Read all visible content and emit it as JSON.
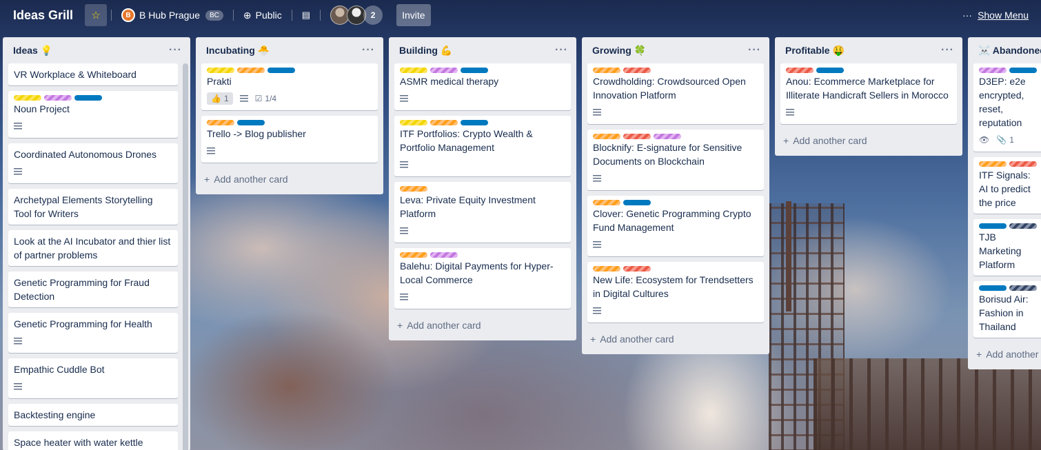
{
  "header": {
    "board_title": "Ideas Grill",
    "team_name": "B Hub Prague",
    "team_badge": "BC",
    "visibility": "Public",
    "member_overflow": "2",
    "invite_label": "Invite",
    "menu_label": "Show Menu"
  },
  "lists": [
    {
      "title": "Ideas 💡",
      "add_label": "Add another card",
      "cards": [
        {
          "title": "VR Workplace & Whiteboard"
        },
        {
          "title": "Noun Project"
        },
        {
          "title": "Coordinated Autonomous Drones"
        },
        {
          "title": "Archetypal Elements Storytelling Tool for Writers"
        },
        {
          "title": "Look at the AI Incubator and thier list of partner problems"
        },
        {
          "title": "Genetic Programming for Fraud Detection"
        },
        {
          "title": "Genetic Programming for Health"
        },
        {
          "title": "Empathic Cuddle Bot"
        },
        {
          "title": "Backtesting engine"
        },
        {
          "title": "Space heater with water kettle"
        }
      ]
    },
    {
      "title": "Incubating 🐣",
      "add_label": "Add another card",
      "cards": [
        {
          "title": "Prakti",
          "votes": "1",
          "checklist": "1/4"
        },
        {
          "title": "Trello -> Blog publisher"
        }
      ]
    },
    {
      "title": "Building 💪",
      "add_label": "Add another card",
      "cards": [
        {
          "title": "ASMR medical therapy"
        },
        {
          "title": "ITF Portfolios: Crypto Wealth & Portfolio Management"
        },
        {
          "title": "Leva: Private Equity Investment Platform"
        },
        {
          "title": "Balehu: Digital Payments for Hyper-Local Commerce"
        }
      ]
    },
    {
      "title": "Growing 🍀",
      "add_label": "Add another card",
      "cards": [
        {
          "title": "Crowdholding: Crowdsourced Open Innovation Platform"
        },
        {
          "title": "Blocknify: E-signature for Sensitive Documents on Blockchain"
        },
        {
          "title": "Clover: Genetic Programming Crypto Fund Management"
        },
        {
          "title": "New Life: Ecosystem for Trendsetters in Digital Cultures"
        }
      ]
    },
    {
      "title": "Profitable 🤑",
      "add_label": "Add another card",
      "cards": [
        {
          "title": "Anou: Ecommerce Marketplace for Illiterate Handicraft Sellers in Morocco"
        }
      ]
    },
    {
      "title": "☠️ Abandoned",
      "add_label": "Add another card",
      "cards": [
        {
          "title": "D3EP: e2e encrypted, reset, reputation",
          "attachments": "1"
        },
        {
          "title": "ITF Signals: AI to predict the price"
        },
        {
          "title": "TJB Marketing Platform"
        },
        {
          "title": "Borisud Air: Fashion in Thailand"
        }
      ]
    }
  ]
}
